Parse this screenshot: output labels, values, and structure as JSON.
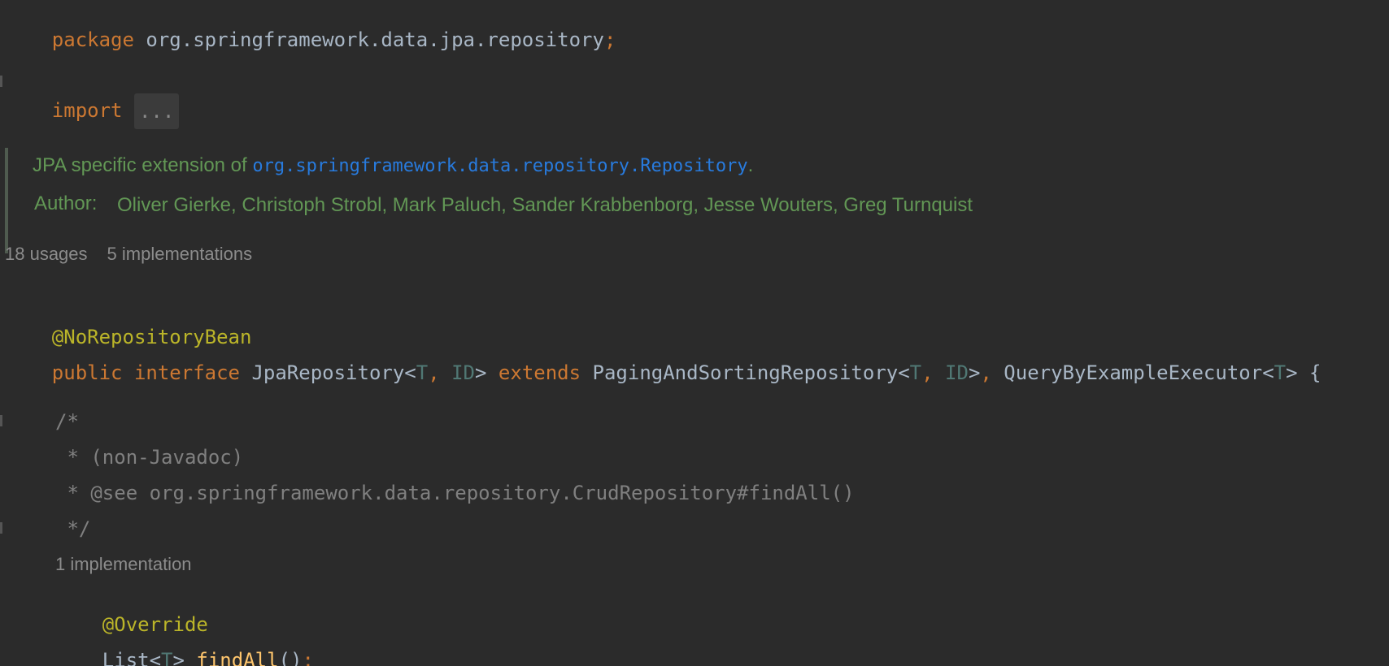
{
  "code": {
    "package_keyword": "package",
    "package_name": "org.springframework.data.jpa.repository",
    "semicolon": ";",
    "import_keyword": "import",
    "import_fold": "...",
    "javadoc": {
      "description_prefix": "JPA specific extension of ",
      "description_link": "org.springframework.data.repository.Repository",
      "description_suffix": ".",
      "author_label": "Author:",
      "authors": "Oliver Gierke, Christoph Strobl, Mark Paluch, Sander Krabbenborg, Jesse Wouters, Greg Turnquist"
    },
    "interface_hints": {
      "usages": "18 usages",
      "implementations": "5 implementations"
    },
    "interface_annotation": "@NoRepositoryBean",
    "declaration": {
      "public_kw": "public",
      "interface_kw": "interface",
      "name": "JpaRepository",
      "lt": "<",
      "type_t": "T",
      "comma": ",",
      "type_id": "ID",
      "gt": ">",
      "extends_kw": "extends",
      "parent1": "PagingAndSortingRepository",
      "parent2": "QueryByExampleExecutor",
      "open_brace": "{"
    },
    "block_comment": {
      "open": "/*",
      "line1": " * (non-Javadoc)",
      "line2": " * @see org.springframework.data.repository.CrudRepository#findAll()",
      "close": " */"
    },
    "method_hint": "1 implementation",
    "method_annotation": "@Override",
    "method": {
      "return_type": "List",
      "type_param": "T",
      "name": "findAll",
      "parens": "()",
      "semicolon": ";"
    }
  }
}
